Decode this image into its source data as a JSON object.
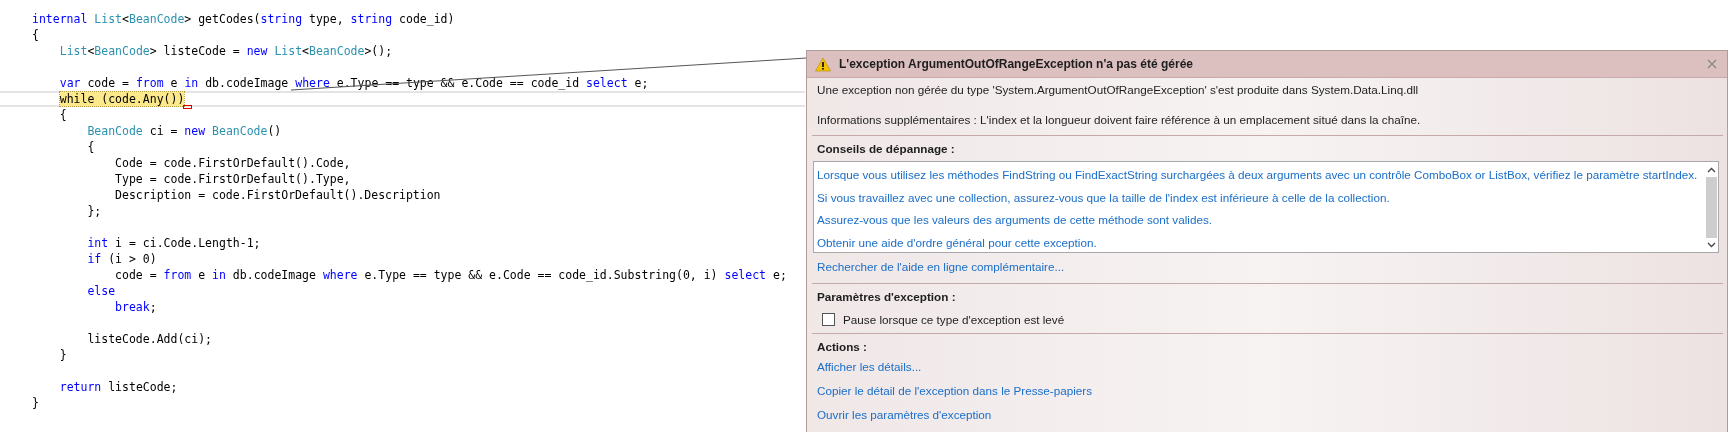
{
  "editor": {
    "blocks": [
      {
        "lines": [
          {
            "current": false,
            "tokens": [
              {
                "text": "internal ",
                "kind": "keyword"
              },
              {
                "text": "List",
                "kind": "type"
              },
              {
                "text": "<",
                "kind": "text"
              },
              {
                "text": "BeanCode",
                "kind": "type"
              },
              {
                "text": "> getCodes(",
                "kind": "text"
              },
              {
                "text": "string",
                "kind": "keyword"
              },
              {
                "text": " type, ",
                "kind": "text"
              },
              {
                "text": "string",
                "kind": "keyword"
              },
              {
                "text": " code_id)",
                "kind": "text"
              }
            ]
          },
          {
            "current": false,
            "tokens": [
              {
                "text": "{",
                "kind": "text"
              }
            ]
          },
          {
            "current": false,
            "tokens": [
              {
                "text": "    List",
                "kind": "type"
              },
              {
                "text": "<",
                "kind": "text"
              },
              {
                "text": "BeanCode",
                "kind": "type"
              },
              {
                "text": "> listeCode = ",
                "kind": "text"
              },
              {
                "text": "new ",
                "kind": "keyword"
              },
              {
                "text": "List",
                "kind": "type"
              },
              {
                "text": "<",
                "kind": "text"
              },
              {
                "text": "BeanCode",
                "kind": "type"
              },
              {
                "text": ">();",
                "kind": "text"
              }
            ]
          }
        ]
      },
      {
        "lines": [
          {
            "current": false,
            "tokens": [
              {
                "text": "    var",
                "kind": "keyword"
              },
              {
                "text": " code = ",
                "kind": "text"
              },
              {
                "text": "from",
                "kind": "keyword"
              },
              {
                "text": " e ",
                "kind": "text"
              },
              {
                "text": "in",
                "kind": "keyword"
              },
              {
                "text": " db.codeImage ",
                "kind": "text"
              },
              {
                "text": "where",
                "kind": "keyword"
              },
              {
                "text": " e.Type == type && e.Code == code_id ",
                "kind": "text"
              },
              {
                "text": "select",
                "kind": "keyword"
              },
              {
                "text": " e;",
                "kind": "text"
              }
            ]
          },
          {
            "current": true,
            "tokens": [
              {
                "text": "    while (code.Any())",
                "kind": "statement"
              }
            ]
          },
          {
            "current": false,
            "tokens": [
              {
                "text": "    {",
                "kind": "text"
              }
            ]
          },
          {
            "current": false,
            "tokens": [
              {
                "text": "        BeanCode",
                "kind": "type"
              },
              {
                "text": " ci = ",
                "kind": "text"
              },
              {
                "text": "new ",
                "kind": "keyword"
              },
              {
                "text": "BeanCode",
                "kind": "type"
              },
              {
                "text": "()",
                "kind": "text"
              }
            ]
          },
          {
            "current": false,
            "tokens": [
              {
                "text": "        {",
                "kind": "text"
              }
            ]
          },
          {
            "current": false,
            "tokens": [
              {
                "text": "            Code = code.FirstOrDefault().Code,",
                "kind": "text"
              }
            ]
          },
          {
            "current": false,
            "tokens": [
              {
                "text": "            Type = code.FirstOrDefault().Type,",
                "kind": "text"
              }
            ]
          },
          {
            "current": false,
            "tokens": [
              {
                "text": "            Description = code.FirstOrDefault().Description",
                "kind": "text"
              }
            ]
          },
          {
            "current": false,
            "tokens": [
              {
                "text": "        };",
                "kind": "text"
              }
            ]
          }
        ]
      },
      {
        "lines": [
          {
            "current": false,
            "tokens": [
              {
                "text": "        int",
                "kind": "keyword"
              },
              {
                "text": " i = ci.Code.Length-1;",
                "kind": "text"
              }
            ]
          },
          {
            "current": false,
            "tokens": [
              {
                "text": "        if",
                "kind": "keyword"
              },
              {
                "text": " (i > 0)",
                "kind": "text"
              }
            ]
          },
          {
            "current": false,
            "tokens": [
              {
                "text": "            code = ",
                "kind": "text"
              },
              {
                "text": "from",
                "kind": "keyword"
              },
              {
                "text": " e ",
                "kind": "text"
              },
              {
                "text": "in",
                "kind": "keyword"
              },
              {
                "text": " db.codeImage ",
                "kind": "text"
              },
              {
                "text": "where",
                "kind": "keyword"
              },
              {
                "text": " e.Type == type && e.Code == code_id.Substring(0, i) ",
                "kind": "text"
              },
              {
                "text": "select",
                "kind": "keyword"
              },
              {
                "text": " e;",
                "kind": "text"
              }
            ]
          },
          {
            "current": false,
            "tokens": [
              {
                "text": "        else",
                "kind": "keyword"
              }
            ]
          },
          {
            "current": false,
            "tokens": [
              {
                "text": "            break",
                "kind": "keyword"
              },
              {
                "text": ";",
                "kind": "text"
              }
            ]
          }
        ]
      },
      {
        "lines": [
          {
            "current": false,
            "tokens": [
              {
                "text": "        listeCode.Add(ci);",
                "kind": "text"
              }
            ]
          },
          {
            "current": false,
            "tokens": [
              {
                "text": "    }",
                "kind": "text"
              }
            ]
          }
        ]
      },
      {
        "lines": [
          {
            "current": false,
            "tokens": [
              {
                "text": "    return",
                "kind": "keyword"
              },
              {
                "text": " listeCode;",
                "kind": "text"
              }
            ]
          },
          {
            "current": false,
            "tokens": [
              {
                "text": "}",
                "kind": "text"
              }
            ]
          }
        ]
      }
    ]
  },
  "exception_dialog": {
    "title": "L'exception ArgumentOutOfRangeException n'a pas été gérée",
    "message": "Une exception non gérée du type 'System.ArgumentOutOfRangeException' s'est produite dans System.Data.Linq.dll",
    "details": "Informations supplémentaires : L'index et la longueur doivent faire référence à un emplacement situé dans la chaîne.",
    "troubleshooting": {
      "heading": "Conseils de dépannage :",
      "tips": [
        "Lorsque vous utilisez les méthodes FindString ou FindExactString surchargées à deux arguments avec un contrôle ComboBox or ListBox, vérifiez le paramètre startIndex.",
        "Si vous travaillez avec une collection, assurez-vous que la taille de l'index est inférieure à celle de la collection.",
        "Assurez-vous que les valeurs des arguments de cette méthode sont valides.",
        "Obtenir une aide d'ordre général pour cette exception."
      ],
      "link": "Rechercher de l'aide en ligne complémentaire..."
    },
    "settings": {
      "heading": "Paramètres d'exception :",
      "checkbox": {
        "label": "Pause lorsque ce type d'exception est levé",
        "checked": false
      }
    },
    "actions": {
      "heading": "Actions :",
      "links": [
        "Afficher les détails...",
        "Copier le détail de l'exception dans le Presse-papiers",
        "Ouvrir les paramètres d'exception"
      ]
    }
  }
}
